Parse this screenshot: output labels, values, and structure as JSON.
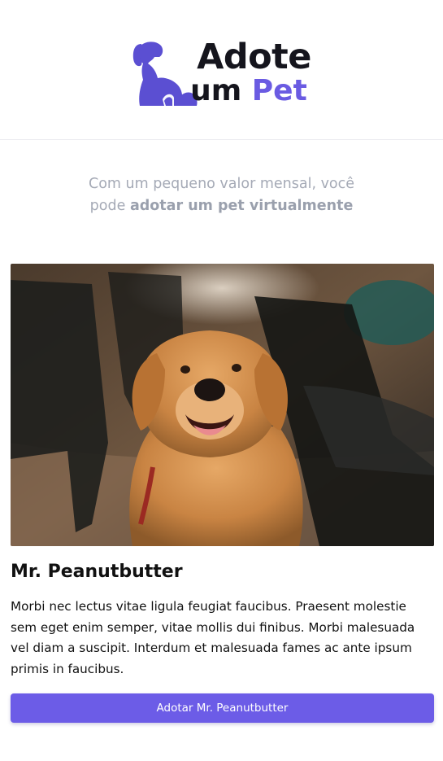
{
  "brand": {
    "logo_line1": "Adote",
    "logo_line2_prefix": "um",
    "logo_line2_accent": "Pet",
    "logo_icon": "dog-silhouette-icon",
    "accent_color": "#6c5ce7",
    "dark_color": "#15151d"
  },
  "intro": {
    "text_line1": "Com um pequeno valor mensal, você",
    "text_line2_prefix": "pode",
    "text_line2_bold": "adotar um pet virtualmente"
  },
  "pet": {
    "photo_subject": "golden-retriever-photo",
    "name": "Mr. Peanutbutter",
    "description": "Morbi nec lectus vitae ligula feugiat faucibus. Praesent molestie sem eget enim semper, vitae mollis dui finibus. Morbi malesuada vel diam a suscipit. Interdum et malesuada fames ac ante ipsum primis in faucibus.",
    "button_label": "Adotar Mr. Peanutbutter"
  }
}
